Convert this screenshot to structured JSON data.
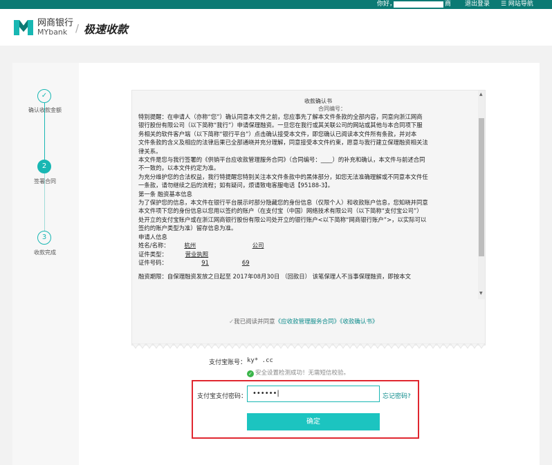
{
  "topbar": {
    "greeting": "你好，",
    "greeting_tail": "商",
    "logout": "退出登录",
    "site_nav": "☰ 网站导航"
  },
  "header": {
    "logo_cn": "网商银行",
    "logo_en": "MYbank",
    "separator": "/",
    "page_title": "极速收款"
  },
  "steps": [
    {
      "num": "✓",
      "label": "确认收款金额"
    },
    {
      "num": "2",
      "label": "签署合同"
    },
    {
      "num": "3",
      "label": "收款完成"
    }
  ],
  "document": {
    "title": "收款确认书",
    "contract_no": "合同编号：",
    "lines": [
      "特别提醒：在申请人（亦称“您”）确认同意本文件之前，您应事先了解本文件条款的全部内容，同意向浙江网商",
      "银行股份有限公司（以下简称“我行”）申请保理融资。一旦您在我行或其关联公司的网站或其他与本合同项下服",
      "务相关的软件客户端（以下简称“银行平台”）点击确认接受本文件，即您确认已阅读本文件所有条款，并对本",
      "文件条款的含义及相应的法律后果已全部通晓并充分理解，同意接受本文件约束，愿意与我行建立保理融资相关法",
      "律关系。",
      "本文件是您与我行签署的《供销平台应收款管理服务合同》（合同编号：____）的补充和确认，本文件与前述合同",
      "不一致的，以本文件约定为准。",
      "为充分维护您的合法权益，我行特提醒您特别关注本文件条款中的黑体部分，如您无法准确理解或不同意本文件任",
      "一条款，请勿继续之后的流程；如有疑问，烦请致电客服电话【95188-3】。",
      "第一条 融资基本信息",
      "为了保护您的信息，本文件在银行平台展示时部分隐藏您的身份信息（仅限个人）和收款账户信息，您知晓并同意",
      "本文件项下您的身份信息以您用以签约的账户（在支付宝（中国）网络技术有限公司（以下简称“支付宝公司”）",
      "处开立的支付宝账户或在浙江网商银行股份有限公司处开立的银行账户<以下简称“网商银行账户”>，以实际可以",
      "签约的账户类型为准）留存信息为准。",
      "申请人信息"
    ],
    "fields": [
      {
        "label": "姓名/名称：",
        "value": "杭州",
        "tail": "公司"
      },
      {
        "label": "证件类型：",
        "value": "营业执照",
        "tail": ""
      },
      {
        "label": "证件号码：",
        "value": "91",
        "tail": "69"
      }
    ],
    "cut_line": "融资期限：自保理融资发放之日起至   2017年08月30日   （回款日）    该笔保理人不当事保理融资，即按本文",
    "agree_prefix": "我已阅读并同意",
    "agree_link1": "《应收款管理服务合同》",
    "agree_link2": "《收款确认书》"
  },
  "account": {
    "label": "支付宝账号：",
    "value": "ky*          .cc",
    "check_msg": "安全设置检测成功！无需短信校验。"
  },
  "password": {
    "label": "支付宝支付密码：",
    "value": "••••••|",
    "forgot": "忘记密码?",
    "confirm": "确定"
  },
  "colors": {
    "brand": "#0b7a74",
    "accent": "#18b7b3",
    "button": "#1cc4c0",
    "highlight_box": "#e0262f",
    "success": "#3ab54a"
  }
}
